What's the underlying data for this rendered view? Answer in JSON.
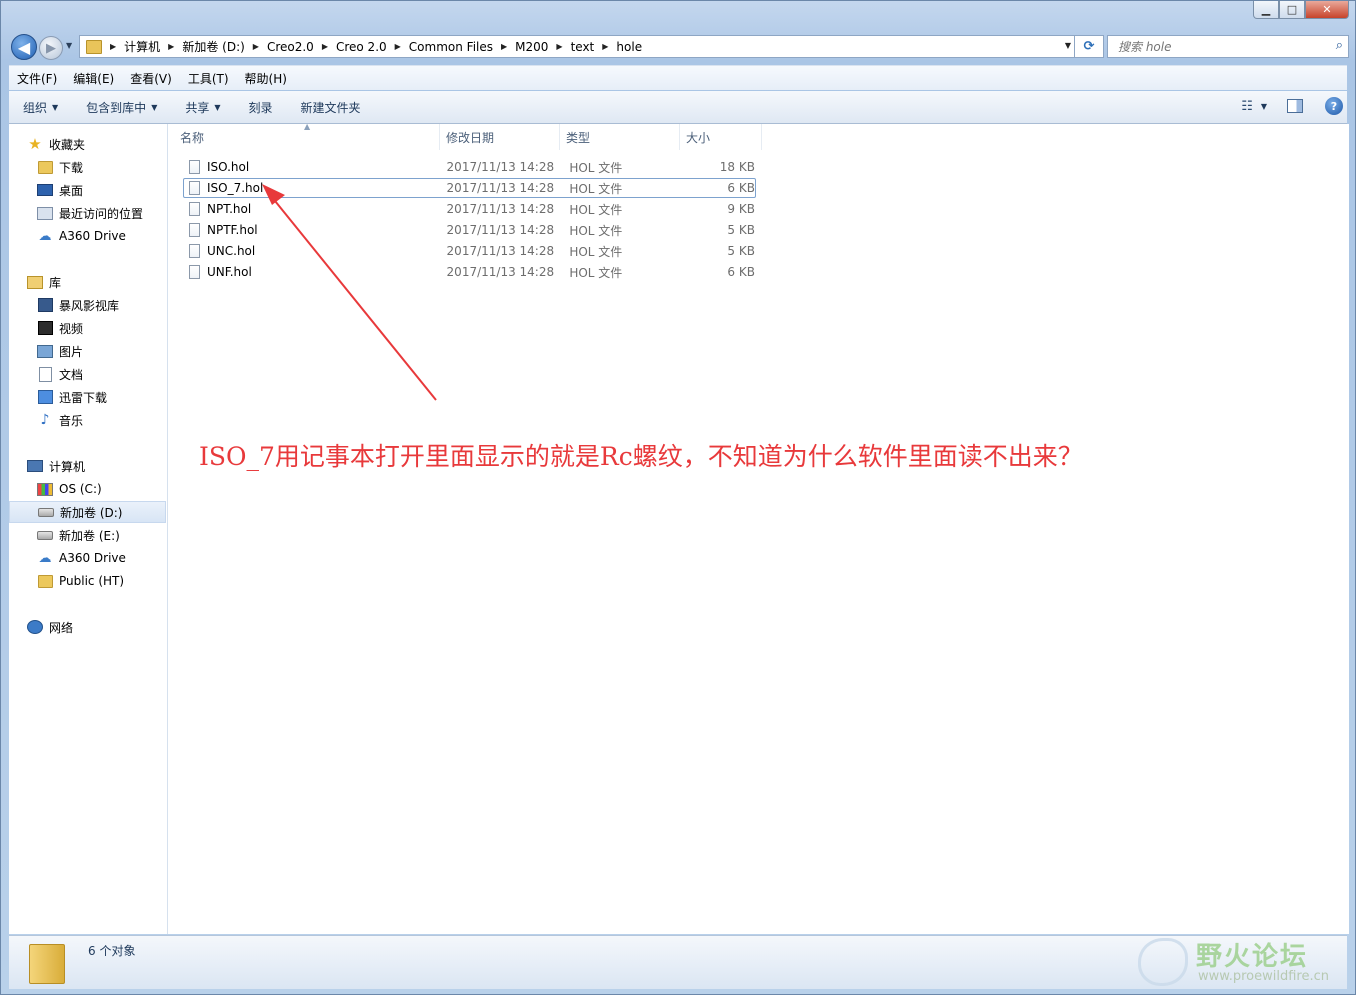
{
  "window": {
    "minimize": "▁",
    "maximize": "□",
    "close": "✕"
  },
  "nav": {
    "back": "◀",
    "forward": "▶",
    "breadcrumbs": [
      "计算机",
      "新加卷 (D:)",
      "Creo2.0",
      "Creo 2.0",
      "Common Files",
      "M200",
      "text",
      "hole"
    ],
    "search_placeholder": "搜索 hole"
  },
  "menubar": [
    "文件(F)",
    "编辑(E)",
    "查看(V)",
    "工具(T)",
    "帮助(H)"
  ],
  "commands": [
    {
      "label": "组织",
      "dropdown": true
    },
    {
      "label": "包含到库中",
      "dropdown": true
    },
    {
      "label": "共享",
      "dropdown": true
    },
    {
      "label": "刻录",
      "dropdown": false
    },
    {
      "label": "新建文件夹",
      "dropdown": false
    }
  ],
  "help": "?",
  "sidebar": {
    "favorites": {
      "label": "收藏夹",
      "items": [
        "下载",
        "桌面",
        "最近访问的位置",
        "A360 Drive"
      ]
    },
    "libraries": {
      "label": "库",
      "items": [
        "暴风影视库",
        "视频",
        "图片",
        "文档",
        "迅雷下载",
        "音乐"
      ]
    },
    "computer": {
      "label": "计算机",
      "items": [
        "OS (C:)",
        "新加卷 (D:)",
        "新加卷 (E:)",
        "A360 Drive",
        "Public (HT)"
      ],
      "selected": "新加卷 (D:)"
    },
    "network": {
      "label": "网络"
    }
  },
  "columns": {
    "name": "名称",
    "date": "修改日期",
    "type": "类型",
    "size": "大小"
  },
  "files": [
    {
      "name": "ISO.hol",
      "date": "2017/11/13 14:28",
      "type": "HOL 文件",
      "size": "18 KB"
    },
    {
      "name": "ISO_7.hol",
      "date": "2017/11/13 14:28",
      "type": "HOL 文件",
      "size": "6 KB",
      "selected": true
    },
    {
      "name": "NPT.hol",
      "date": "2017/11/13 14:28",
      "type": "HOL 文件",
      "size": "9 KB"
    },
    {
      "name": "NPTF.hol",
      "date": "2017/11/13 14:28",
      "type": "HOL 文件",
      "size": "5 KB"
    },
    {
      "name": "UNC.hol",
      "date": "2017/11/13 14:28",
      "type": "HOL 文件",
      "size": "5 KB"
    },
    {
      "name": "UNF.hol",
      "date": "2017/11/13 14:28",
      "type": "HOL 文件",
      "size": "6 KB"
    }
  ],
  "annotation": {
    "text": "ISO_7用记事本打开里面显示的就是Rc螺纹，不知道为什么软件里面读不出来？",
    "color": "#e8393b"
  },
  "status": {
    "text": "6 个对象"
  },
  "watermark": {
    "title": "野火论坛",
    "url": "www.proewildfire.cn"
  }
}
